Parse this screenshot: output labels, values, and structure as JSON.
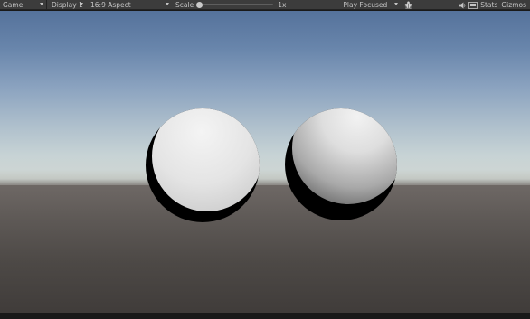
{
  "toolbar": {
    "view_mode": "Game",
    "display": "Display 1",
    "aspect": "16:9 Aspect",
    "scale_label": "Scale",
    "scale_value": "1x",
    "play_mode": "Play Focused",
    "stats_label": "Stats",
    "gizmos_label": "Gizmos"
  },
  "scene": {
    "objects": [
      "sphere",
      "sphere"
    ]
  },
  "icons": {
    "bug": "bug-icon",
    "audio": "speaker-icon",
    "render_stats": "render-stats-icon",
    "gizmos_menu": "chevron-down-icon"
  },
  "colors": {
    "toolbar_bg": "#3c3c3c",
    "toolbar_text": "#c4c4c4",
    "sky_top": "#55729b",
    "horizon": "#d0d6d3",
    "ground": "#4d4946",
    "sphere_lit": "#ececec",
    "sphere_shadow": "#000000"
  }
}
